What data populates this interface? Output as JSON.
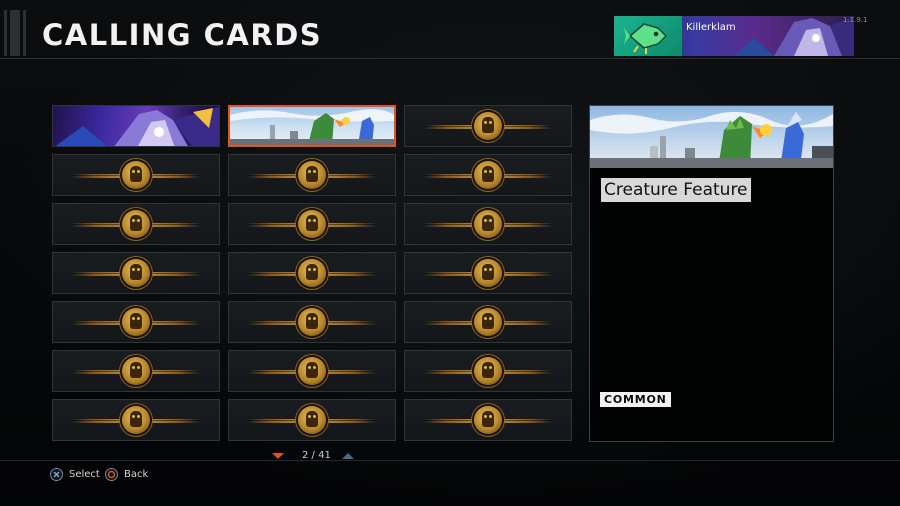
{
  "header": {
    "title": "CALLING CARDS",
    "build_label": "1.1.9.1",
    "player": {
      "name": "Killerklam",
      "emblem_icon": "fish-emblem-icon"
    }
  },
  "grid": {
    "columns": 3,
    "rows": 7,
    "cards": [
      {
        "art": "mecha",
        "locked": false,
        "selected": false
      },
      {
        "art": "creature",
        "locked": false,
        "selected": true
      },
      {
        "art": "locked",
        "locked": true,
        "selected": false
      },
      {
        "art": "locked",
        "locked": true,
        "selected": false
      },
      {
        "art": "locked",
        "locked": true,
        "selected": false
      },
      {
        "art": "locked",
        "locked": true,
        "selected": false
      },
      {
        "art": "locked",
        "locked": true,
        "selected": false
      },
      {
        "art": "locked",
        "locked": true,
        "selected": false
      },
      {
        "art": "locked",
        "locked": true,
        "selected": false
      },
      {
        "art": "locked",
        "locked": true,
        "selected": false
      },
      {
        "art": "locked",
        "locked": true,
        "selected": false
      },
      {
        "art": "locked",
        "locked": true,
        "selected": false
      },
      {
        "art": "locked",
        "locked": true,
        "selected": false
      },
      {
        "art": "locked",
        "locked": true,
        "selected": false
      },
      {
        "art": "locked",
        "locked": true,
        "selected": false
      },
      {
        "art": "locked",
        "locked": true,
        "selected": false
      },
      {
        "art": "locked",
        "locked": true,
        "selected": false
      },
      {
        "art": "locked",
        "locked": true,
        "selected": false
      },
      {
        "art": "locked",
        "locked": true,
        "selected": false
      },
      {
        "art": "locked",
        "locked": true,
        "selected": false
      },
      {
        "art": "locked",
        "locked": true,
        "selected": false
      }
    ]
  },
  "pager": {
    "text": "2 / 41",
    "current": 2,
    "total": 41
  },
  "detail": {
    "name": "Creature Feature",
    "rarity": "COMMON"
  },
  "footer": {
    "select": {
      "label": "Select",
      "icon": "cross-button-icon"
    },
    "back": {
      "label": "Back",
      "icon": "circle-button-icon"
    }
  },
  "colors": {
    "accent": "#e4521e",
    "cross_button": "#7ab0e0",
    "circle_button": "#e4521e",
    "emblem": "#1ab48e"
  }
}
